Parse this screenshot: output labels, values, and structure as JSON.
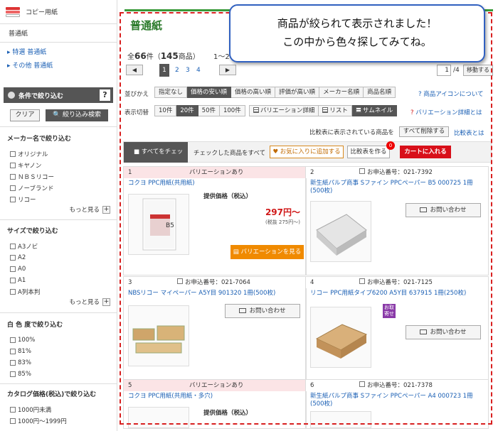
{
  "sidebar": {
    "category": "コピー用紙",
    "sub": "普通紙",
    "links": [
      "特選 普通紙",
      "その他 普通紙"
    ],
    "filter_title": "条件で絞り込む",
    "help": "?",
    "clear": "クリア",
    "search": "絞り込み検索",
    "groups": [
      {
        "title": "メーカー名で絞り込む",
        "options": [
          "オリジナル",
          "キヤノン",
          "ＮＢＳリコー",
          "ノーブランド",
          "リコー"
        ],
        "more": "もっと見る"
      },
      {
        "title": "サイズで絞り込む",
        "options": [
          "A3ノビ",
          "A2",
          "A0",
          "A1",
          "A列本判"
        ],
        "more": "もっと見る"
      },
      {
        "title": "白 色 度で絞り込む",
        "options": [
          "100%",
          "81%",
          "83%",
          "85%"
        ]
      },
      {
        "title": "カタログ価格(税込)で絞り込む",
        "options": [
          "1000円未満",
          "1000円〜1999円"
        ]
      }
    ]
  },
  "main": {
    "title": "普通紙",
    "count_prefix": "全",
    "count_items": "66",
    "count_mid": "件（",
    "count_products": "145",
    "count_suffix": "商品）",
    "range": "1〜20",
    "pager": {
      "prev": "◀",
      "next": "▶",
      "current": "1",
      "pages": [
        "2",
        "3",
        "4"
      ],
      "page_input": "1",
      "total": "/4",
      "go": "移動する"
    },
    "sort": {
      "label": "並びかえ",
      "options": [
        "指定なし",
        "価格の安い順",
        "価格の高い順",
        "評価が高い順",
        "メーカー名順",
        "商品名順"
      ],
      "selected": 1,
      "link": "商品アイコンについて"
    },
    "display": {
      "label": "表示切替",
      "counts": [
        "10件",
        "20件",
        "50件",
        "100件"
      ],
      "selected_count": 1,
      "views": [
        "バリエーション詳細",
        "リスト",
        "サムネイル"
      ],
      "selected_view": 2,
      "link": "バリエーション詳細とは"
    },
    "compare_text": "比較表に表示されている商品を",
    "compare_delete": "すべて削除する",
    "compare_link": "比較表とは",
    "actions": {
      "check_all": "すべてをチェック",
      "checked_label": "チェックした商品をすべて",
      "fav": "お気に入りに追加する",
      "compare": "比較表を作る",
      "badge": "0",
      "cart": "カートに入れる"
    },
    "products": [
      {
        "no": "1",
        "variation": "バリエーションあり",
        "name": "コクヨ PPC用紙(共用紙)",
        "price_label": "提供価格（税込）",
        "price": "297円〜",
        "tax": "(税抜 275円〜)",
        "button": "バリエーションを見る"
      },
      {
        "no": "2",
        "order": "お申込番号：021-7392",
        "name": "新生紙パルプ商事 Sファイン PPCペーパー B5 000725 1冊(500枚)",
        "button": "お問い合わせ"
      },
      {
        "no": "3",
        "order": "お申込番号：021-7064",
        "name": "NBSリコー マイペーパー A5Y目 901320 1冊(500枚)",
        "button": "お問い合わせ"
      },
      {
        "no": "4",
        "order": "お申込番号：021-7125",
        "name": "リコー PPC用紙タイプ6200 A5Y目 637915 1冊(250枚)",
        "button": "お問い合わせ",
        "tag": "お取寄せ"
      },
      {
        "no": "5",
        "variation": "バリエーションあり",
        "name": "コクヨ PPC用紙(共用紙・多穴)",
        "price_label": "提供価格（税込）"
      },
      {
        "no": "6",
        "order": "お申込番号：021-7378",
        "name": "新生紙パルプ商事 Sファイン PPCペーパー A4 000723 1冊(500枚)"
      }
    ]
  },
  "callout": {
    "line1": "商品が絞られて表示されました！",
    "line2": "この中から色々探してみてね。"
  },
  "colors": {
    "accent_green": "#3a9a3a",
    "cart_red": "#d8101a",
    "dash_red": "#d82020",
    "variation_orange": "#f08a00"
  }
}
